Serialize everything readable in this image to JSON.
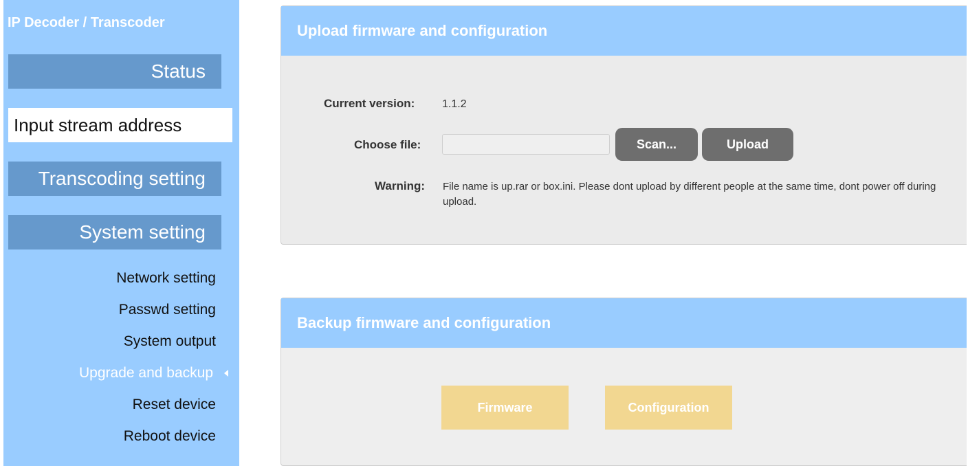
{
  "sidebar": {
    "app_title": "IP Decoder / Transcoder",
    "nav": [
      {
        "label": "Status"
      },
      {
        "label": "Input stream address"
      },
      {
        "label": "Transcoding setting"
      },
      {
        "label": "System setting"
      }
    ],
    "sub_items": [
      {
        "label": "Network setting"
      },
      {
        "label": "Passwd setting"
      },
      {
        "label": "System output"
      },
      {
        "label": "Upgrade and backup"
      },
      {
        "label": "Reset device"
      },
      {
        "label": "Reboot device"
      }
    ],
    "current_sub_item": "Upgrade and backup"
  },
  "upload_panel": {
    "title": "Upload firmware and configuration",
    "current_version_label": "Current version:",
    "current_version_value": "1.1.2",
    "choose_file_label": "Choose file:",
    "file_input_value": "",
    "scan_button": "Scan...",
    "upload_button": "Upload",
    "warning_label": "Warning:",
    "warning_text": "File name is up.rar or box.ini. Please dont upload by different people at the same time, dont power off during upload."
  },
  "backup_panel": {
    "title": "Backup firmware and configuration",
    "firmware_button": "Firmware",
    "configuration_button": "Configuration"
  },
  "colors": {
    "sidebar_bg": "#99ccff",
    "nav_bg": "#6699cc",
    "panel_header_bg": "#99ccff",
    "panel_bg": "#ebebeb",
    "gray_button": "#6e6e6e",
    "yellow_button": "#f2d791"
  },
  "icons": {
    "current_item_indicator": "caret-left-icon"
  }
}
